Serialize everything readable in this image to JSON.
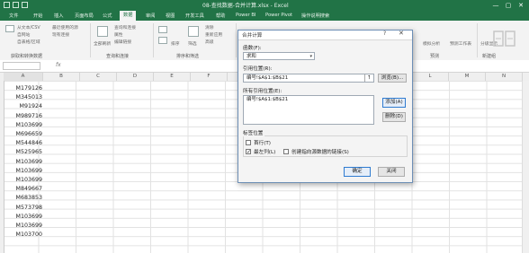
{
  "titlebar": {
    "title": "08-查找数据-合并计算.xlsx - Excel",
    "minimize": "—",
    "maximize": "▢",
    "close": "✕"
  },
  "tabs": [
    {
      "label": "文件"
    },
    {
      "label": "开始"
    },
    {
      "label": "插入"
    },
    {
      "label": "页面布局"
    },
    {
      "label": "公式"
    },
    {
      "label": "数据"
    },
    {
      "label": "审阅"
    },
    {
      "label": "视图"
    },
    {
      "label": "开发工具"
    },
    {
      "label": "帮助"
    },
    {
      "label": "Power BI"
    },
    {
      "label": "Power Pivot"
    }
  ],
  "search_hint": "操作说明搜索",
  "ribbon": {
    "get_data": {
      "label": "从文本/CSV",
      "label2": "自网站",
      "label3": "自表格/区域"
    },
    "recent_sources": "最近使用的源",
    "existing_conn": "现有连接",
    "refresh_all": "全部刷新",
    "query_conn": "查询和连接",
    "properties": "属性",
    "edit_links": "编辑链接",
    "sort": "排序",
    "filter": "筛选",
    "clear": "清除",
    "reapply": "重新应用",
    "advanced": "高级",
    "what_if": "模拟分析",
    "forecast": "预测工作表",
    "outline": "分级显示",
    "group_labels": {
      "get_transform": "获取和转换数据",
      "queries": "查询和连接",
      "sort_filter": "排序和筛选",
      "forecast": "预测",
      "new_group": "新建组"
    }
  },
  "formula_bar": {
    "fx": "fx"
  },
  "columns": [
    "A",
    "B",
    "C",
    "D",
    "E",
    "F",
    "G",
    "H",
    "I",
    "J",
    "K",
    "L",
    "M",
    "N"
  ],
  "cells": [
    "M179126",
    "M345013",
    "M91924",
    "M989716",
    "M103699",
    "M696659",
    "M544846",
    "M525965",
    "M103699",
    "M103699",
    "M103699",
    "M849667",
    "M683853",
    "M573798",
    "M103699",
    "M103699",
    "M103700"
  ],
  "dialog": {
    "title": "合并计算",
    "help": "?",
    "close": "✕",
    "function_label": "函数(F):",
    "function_value": "求和",
    "reference_label": "引用位置(R):",
    "reference_value": "编号!$A$1:$B$21",
    "browse_button": "浏览(B)...",
    "all_refs_label": "所有引用位置(E):",
    "all_refs": [
      "编号!$A$1:$B$21"
    ],
    "add_button": "添加(A)",
    "delete_button": "删除(D)",
    "tag_label": "标签位置",
    "first_row_label": "首行(T)",
    "first_row_checked": false,
    "left_col_label": "最左列(L)",
    "left_col_checked": true,
    "link_label": "创建指向源数据的链接(S)",
    "link_checked": false,
    "ok_button": "确定",
    "close_button": "关闭"
  }
}
